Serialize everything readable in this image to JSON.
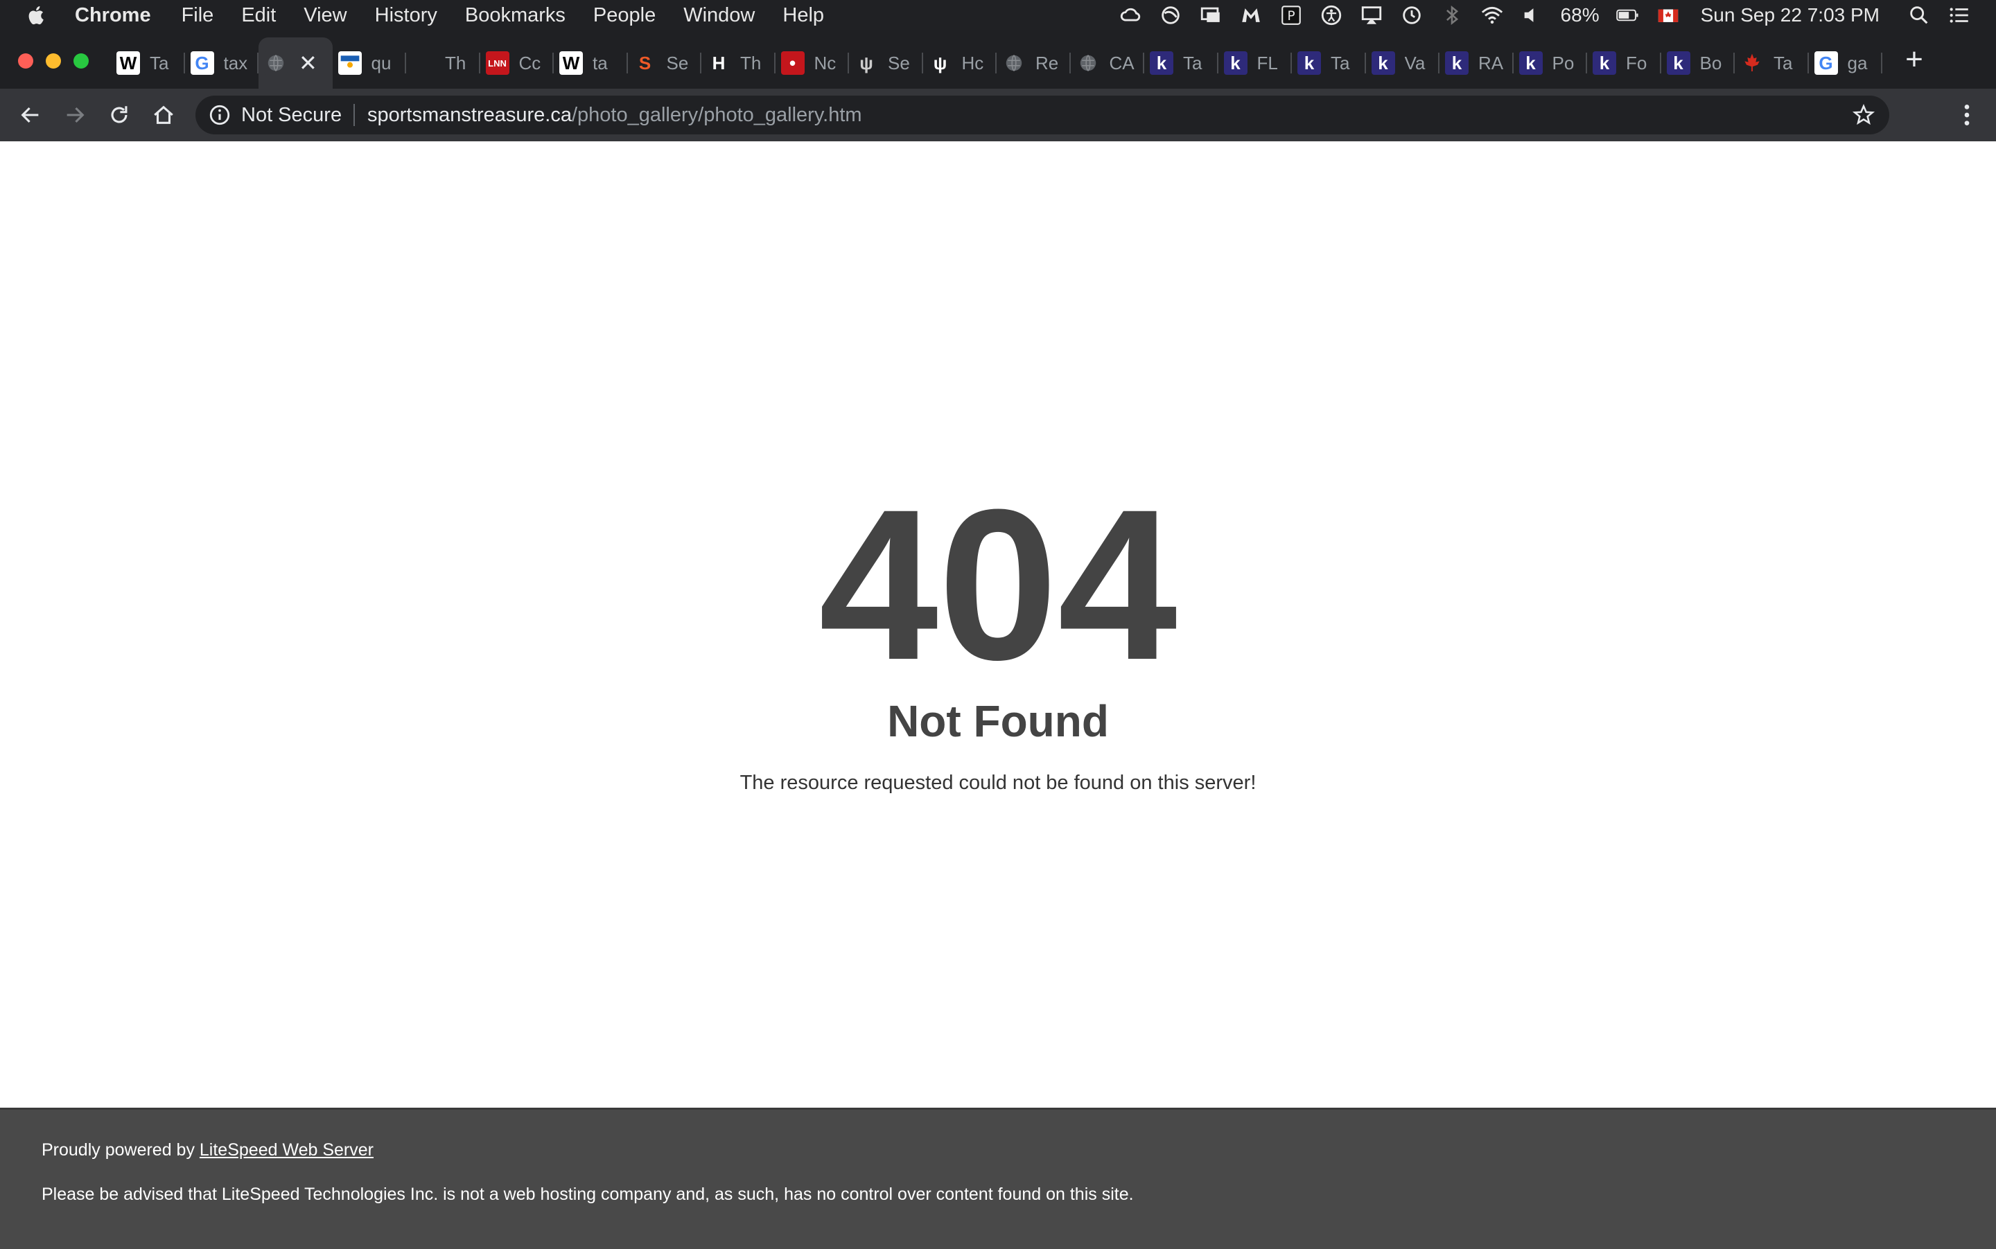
{
  "menubar": {
    "app": "Chrome",
    "items": [
      "File",
      "Edit",
      "View",
      "History",
      "Bookmarks",
      "People",
      "Window",
      "Help"
    ],
    "battery": "68%",
    "datetime": "Sun Sep 22  7:03 PM"
  },
  "tabs": [
    {
      "title": "Ta",
      "favicon": "W",
      "fav_bg": "#ffffff",
      "fav_fg": "#000000"
    },
    {
      "title": "tax",
      "favicon": "G",
      "fav_bg": "#ffffff",
      "fav_fg": "#4285f4"
    },
    {
      "title": "",
      "favicon": "globe",
      "fav_bg": "#35363a",
      "fav_fg": "#5f6368",
      "active": true
    },
    {
      "title": "qu",
      "favicon": "flag",
      "fav_bg": "#ffffff",
      "fav_fg": "#1a5fb4"
    },
    {
      "title": "Th",
      "favicon": "",
      "fav_bg": "transparent",
      "fav_fg": "#ffffff"
    },
    {
      "title": "Cc",
      "favicon": "LNN",
      "fav_bg": "#c4161c",
      "fav_fg": "#ffffff"
    },
    {
      "title": "ta",
      "favicon": "W",
      "fav_bg": "#ffffff",
      "fav_fg": "#000000"
    },
    {
      "title": "Se",
      "favicon": "S",
      "fav_bg": "transparent",
      "fav_fg": "#f05a28"
    },
    {
      "title": "Th",
      "favicon": "H",
      "fav_bg": "transparent",
      "fav_fg": "#ffffff"
    },
    {
      "title": "Nc",
      "favicon": "•",
      "fav_bg": "#c4161c",
      "fav_fg": "#ffffff"
    },
    {
      "title": "Se",
      "favicon": "ψ",
      "fav_bg": "transparent",
      "fav_fg": "#cccccc"
    },
    {
      "title": "Hc",
      "favicon": "ψ",
      "fav_bg": "transparent",
      "fav_fg": "#ffffff"
    },
    {
      "title": "Re",
      "favicon": "globe",
      "fav_bg": "transparent",
      "fav_fg": "#5f6368"
    },
    {
      "title": "CA",
      "favicon": "globe",
      "fav_bg": "transparent",
      "fav_fg": "#5f6368"
    },
    {
      "title": "Ta",
      "favicon": "k",
      "fav_bg": "#2e2a7a",
      "fav_fg": "#ffffff"
    },
    {
      "title": "FL",
      "favicon": "k",
      "fav_bg": "#2e2a7a",
      "fav_fg": "#ffffff"
    },
    {
      "title": "Ta",
      "favicon": "k",
      "fav_bg": "#2e2a7a",
      "fav_fg": "#ffffff"
    },
    {
      "title": "Va",
      "favicon": "k",
      "fav_bg": "#2e2a7a",
      "fav_fg": "#ffffff"
    },
    {
      "title": "RA",
      "favicon": "k",
      "fav_bg": "#2e2a7a",
      "fav_fg": "#ffffff"
    },
    {
      "title": "Po",
      "favicon": "k",
      "fav_bg": "#2e2a7a",
      "fav_fg": "#ffffff"
    },
    {
      "title": "Fo",
      "favicon": "k",
      "fav_bg": "#2e2a7a",
      "fav_fg": "#ffffff"
    },
    {
      "title": "Bo",
      "favicon": "k",
      "fav_bg": "#2e2a7a",
      "fav_fg": "#ffffff"
    },
    {
      "title": "Ta",
      "favicon": "maple",
      "fav_bg": "transparent",
      "fav_fg": "#d52b1e"
    },
    {
      "title": "ga",
      "favicon": "G",
      "fav_bg": "#ffffff",
      "fav_fg": "#4285f4"
    }
  ],
  "omnibox": {
    "security": "Not Secure",
    "domain": "sportsmanstreasure.ca",
    "path": "/photo_gallery/photo_gallery.htm"
  },
  "page": {
    "code": "404",
    "title": "Not Found",
    "message": "The resource requested could not be found on this server!"
  },
  "footer": {
    "powered_prefix": "Proudly powered by ",
    "powered_link": "LiteSpeed Web Server",
    "disclaimer": "Please be advised that LiteSpeed Technologies Inc. is not a web hosting company and, as such, has no control over content found on this site."
  }
}
